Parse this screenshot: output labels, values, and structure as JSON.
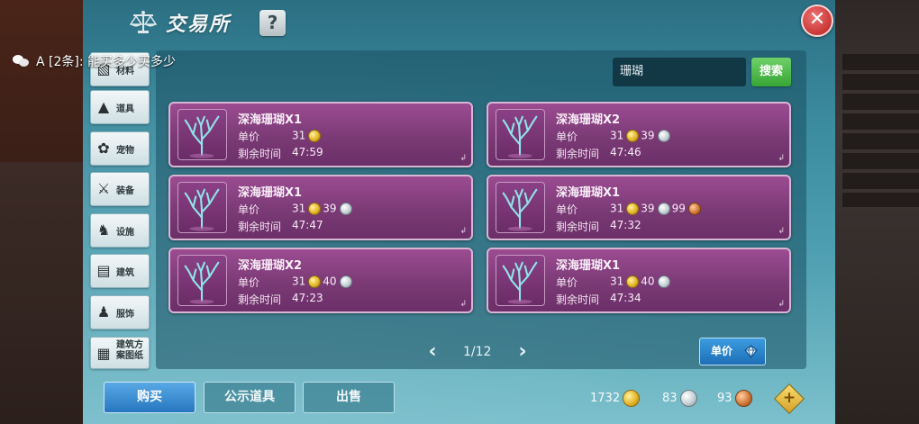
{
  "header": {
    "title": "交易所",
    "help_label": "?",
    "close_label": "✕"
  },
  "chat_overlay": {
    "text": "A [2条]: 能买多少买多少"
  },
  "sidebar": {
    "items": [
      {
        "label": "材料",
        "icon": "material-icon"
      },
      {
        "label": "道具",
        "icon": "flask-icon"
      },
      {
        "label": "宠物",
        "icon": "paw-icon"
      },
      {
        "label": "装备",
        "icon": "sword-shield-icon"
      },
      {
        "label": "设施",
        "icon": "facility-icon"
      },
      {
        "label": "建筑",
        "icon": "brick-icon"
      },
      {
        "label": "服饰",
        "icon": "shirt-icon"
      },
      {
        "label": "建筑方案图纸",
        "icon": "blueprint-icon"
      }
    ]
  },
  "search": {
    "value": "珊瑚",
    "button_label": "搜索"
  },
  "labels": {
    "price": "单价",
    "time": "剩余时间"
  },
  "listings": [
    {
      "name": "深海珊瑚X1",
      "gold": "31",
      "silver": "",
      "copper": "",
      "time": "47:59"
    },
    {
      "name": "深海珊瑚X2",
      "gold": "31",
      "silver": "39",
      "copper": "",
      "time": "47:46"
    },
    {
      "name": "深海珊瑚X1",
      "gold": "31",
      "silver": "39",
      "copper": "",
      "time": "47:47"
    },
    {
      "name": "深海珊瑚X1",
      "gold": "31",
      "silver": "39",
      "copper": "99",
      "time": "47:32"
    },
    {
      "name": "深海珊瑚X2",
      "gold": "31",
      "silver": "40",
      "copper": "",
      "time": "47:23"
    },
    {
      "name": "深海珊瑚X1",
      "gold": "31",
      "silver": "40",
      "copper": "",
      "time": "47:34"
    }
  ],
  "pager": {
    "text": "1/12",
    "prev": "‹",
    "next": "›"
  },
  "sort": {
    "label": "单价"
  },
  "footer": {
    "buy": "购买",
    "public": "公示道具",
    "sell": "出售"
  },
  "wallet": {
    "gold": "1732",
    "silver": "83",
    "copper": "93",
    "add": "+"
  },
  "colors": {
    "card_bg": "#7a3a75",
    "card_border": "#d7b7d4",
    "panel": "#3c8ca0",
    "search_btn": "#37a634",
    "buy_btn": "#2776c0"
  }
}
